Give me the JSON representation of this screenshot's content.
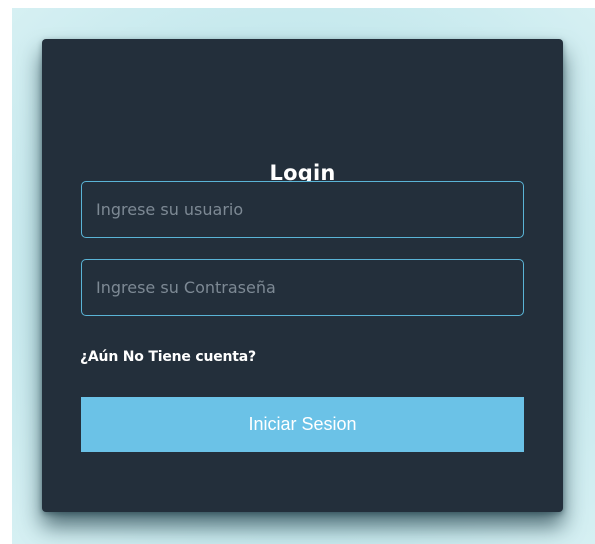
{
  "login": {
    "title": "Login",
    "username_placeholder": "Ingrese su usuario",
    "password_placeholder": "Ingrese su Contraseña",
    "signup_link": "¿Aún No Tiene cuenta?",
    "submit_label": "Iniciar Sesion"
  },
  "colors": {
    "card_background": "#232f3b",
    "input_border": "#5ab4d6",
    "button_background": "#6bc2e7",
    "page_backdrop": "#c2e7ec"
  }
}
